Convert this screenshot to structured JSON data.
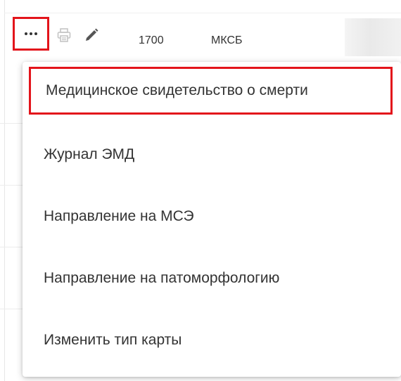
{
  "row": {
    "number": "1700",
    "type": "МКСБ",
    "more_icon": "ellipsis-icon",
    "print_icon": "printer-icon",
    "edit_icon": "pencil-icon",
    "highlight_color": "#e3141b"
  },
  "menu": {
    "items": [
      {
        "label": "Медицинское свидетельство о смерти",
        "highlighted": true
      },
      {
        "label": "Журнал ЭМД"
      },
      {
        "label": "Направление на МСЭ"
      },
      {
        "label": "Направление на патоморфологию"
      },
      {
        "label": "Изменить тип карты"
      }
    ]
  }
}
